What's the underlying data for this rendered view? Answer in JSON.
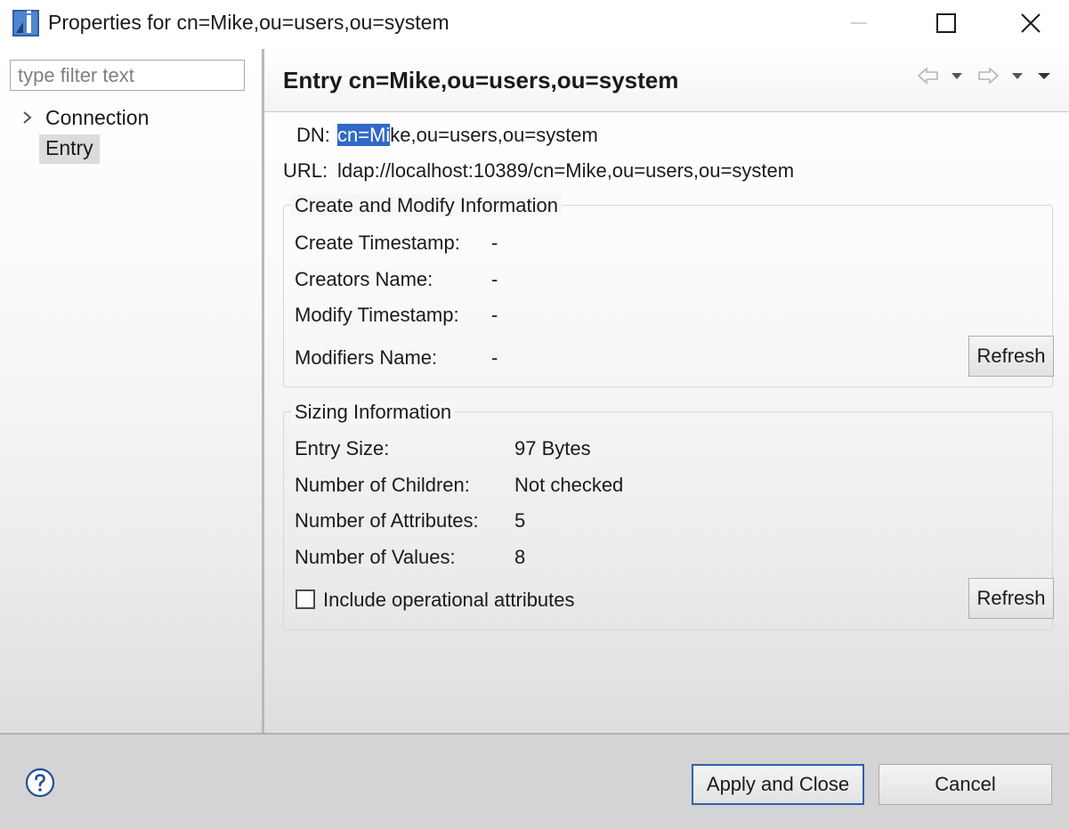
{
  "window": {
    "title": "Properties for cn=Mike,ou=users,ou=system"
  },
  "sidebar": {
    "filter_placeholder": "type filter text",
    "items": [
      {
        "label": "Connection",
        "expandable": true
      },
      {
        "label": "Entry",
        "selected": true
      }
    ]
  },
  "page": {
    "title": "Entry cn=Mike,ou=users,ou=system",
    "dn_label": "DN:",
    "dn_selected": "cn=Mi",
    "dn_rest": "ke,ou=users,ou=system",
    "url_label": "URL:",
    "url_value": "ldap://localhost:10389/cn=Mike,ou=users,ou=system"
  },
  "create_modify": {
    "title": "Create and Modify Information",
    "rows": [
      {
        "label": "Create Timestamp:",
        "value": "-"
      },
      {
        "label": "Creators Name:",
        "value": "-"
      },
      {
        "label": "Modify Timestamp:",
        "value": "-"
      },
      {
        "label": "Modifiers Name:",
        "value": "-"
      }
    ],
    "refresh_label": "Refresh"
  },
  "sizing": {
    "title": "Sizing Information",
    "rows": [
      {
        "label": "Entry Size:",
        "value": "97 Bytes"
      },
      {
        "label": "Number of Children:",
        "value": "Not checked"
      },
      {
        "label": "Number of Attributes:",
        "value": "5"
      },
      {
        "label": "Number of Values:",
        "value": "8"
      }
    ],
    "include_operational_label": "Include operational attributes",
    "include_operational_checked": false,
    "refresh_label": "Refresh"
  },
  "footer": {
    "apply_label": "Apply and Close",
    "cancel_label": "Cancel"
  },
  "colors": {
    "selection_highlight": "#3169c6",
    "default_button_border": "#2f5fb0"
  },
  "icons": [
    "app-icon",
    "minimize-icon",
    "maximize-icon",
    "close-icon",
    "chevron-right-icon",
    "back-arrow-icon",
    "forward-arrow-icon",
    "dropdown-triangle-icon",
    "view-menu-icon",
    "help-icon"
  ]
}
